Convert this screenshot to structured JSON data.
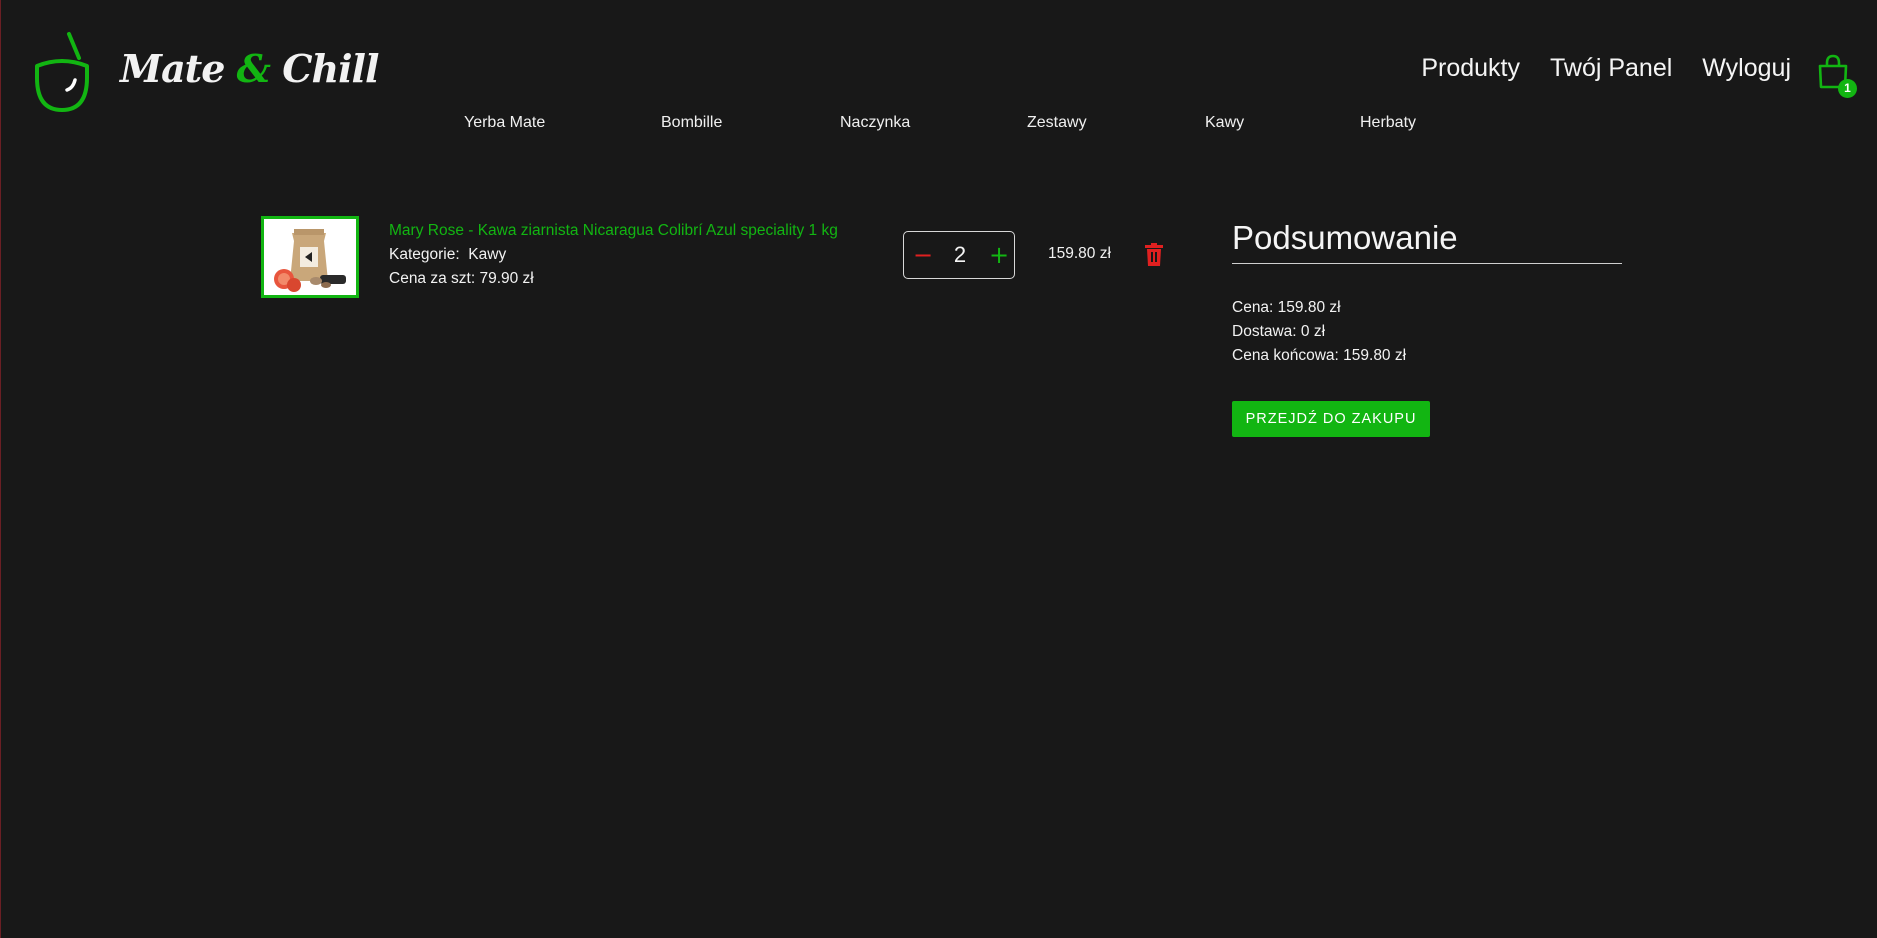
{
  "brand": {
    "name_part1": "Mate ",
    "ampersand": "&",
    "name_part2": " Chill",
    "logo_icon": "mate-cup-icon"
  },
  "top_nav": {
    "items": [
      "Produkty",
      "Twój Panel",
      "Wyloguj"
    ],
    "cart_icon": "shopping-bag-icon",
    "cart_count": "1"
  },
  "category_nav": {
    "items": [
      "Yerba Mate",
      "Bombille",
      "Naczynka",
      "Zestawy",
      "Kawy",
      "Herbaty"
    ]
  },
  "cart_item": {
    "title": "Mary Rose - Kawa ziarnista Nicaragua Colibrí Azul speciality 1 kg",
    "category_label": "Kategorie:",
    "category_value": "Kawy",
    "unit_price": "Cena za szt: 79.90 zł",
    "quantity": "2",
    "decrease_symbol": "−",
    "increase_symbol": "+",
    "line_total": "159.80 zł",
    "delete_icon": "trash-icon"
  },
  "summary": {
    "title": "Podsumowanie",
    "price": "Cena: 159.80 zł",
    "shipping": "Dostawa: 0 zł",
    "final_price": "Cena końcowa: 159.80 zł",
    "checkout_label": "PRZEJDŹ DO ZAKUPU"
  },
  "colors": {
    "background": "#181818",
    "accent_green": "#12b512",
    "danger_red": "#e02020",
    "text": "#f2f2f2"
  }
}
